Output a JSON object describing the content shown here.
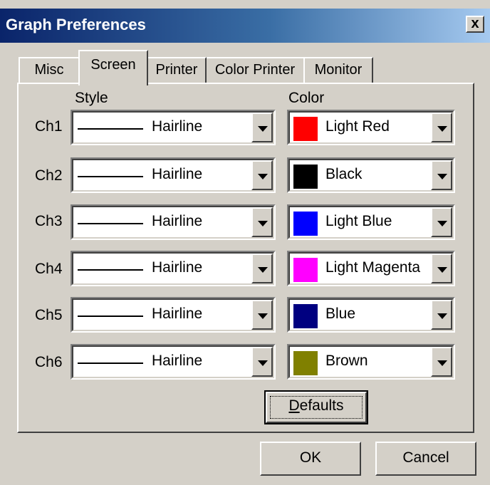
{
  "window": {
    "title": "Graph Preferences",
    "close_label": "x"
  },
  "tabs": [
    {
      "label": "Misc"
    },
    {
      "label": "Screen"
    },
    {
      "label": "Printer"
    },
    {
      "label": "Color Printer"
    },
    {
      "label": "Monitor"
    }
  ],
  "headers": {
    "style": "Style",
    "color": "Color"
  },
  "channels": [
    {
      "label": "Ch1",
      "style": "Hairline",
      "color_name": "Light Red",
      "color_hex": "#ff0000"
    },
    {
      "label": "Ch2",
      "style": "Hairline",
      "color_name": "Black",
      "color_hex": "#000000"
    },
    {
      "label": "Ch3",
      "style": "Hairline",
      "color_name": "Light Blue",
      "color_hex": "#0000ff"
    },
    {
      "label": "Ch4",
      "style": "Hairline",
      "color_name": "Light Magenta",
      "color_hex": "#ff00ff"
    },
    {
      "label": "Ch5",
      "style": "Hairline",
      "color_name": "Blue",
      "color_hex": "#000080"
    },
    {
      "label": "Ch6",
      "style": "Hairline",
      "color_name": "Brown",
      "color_hex": "#808000"
    }
  ],
  "buttons": {
    "defaults_mnemonic": "D",
    "defaults_rest": "efaults",
    "ok": "OK",
    "cancel": "Cancel"
  }
}
